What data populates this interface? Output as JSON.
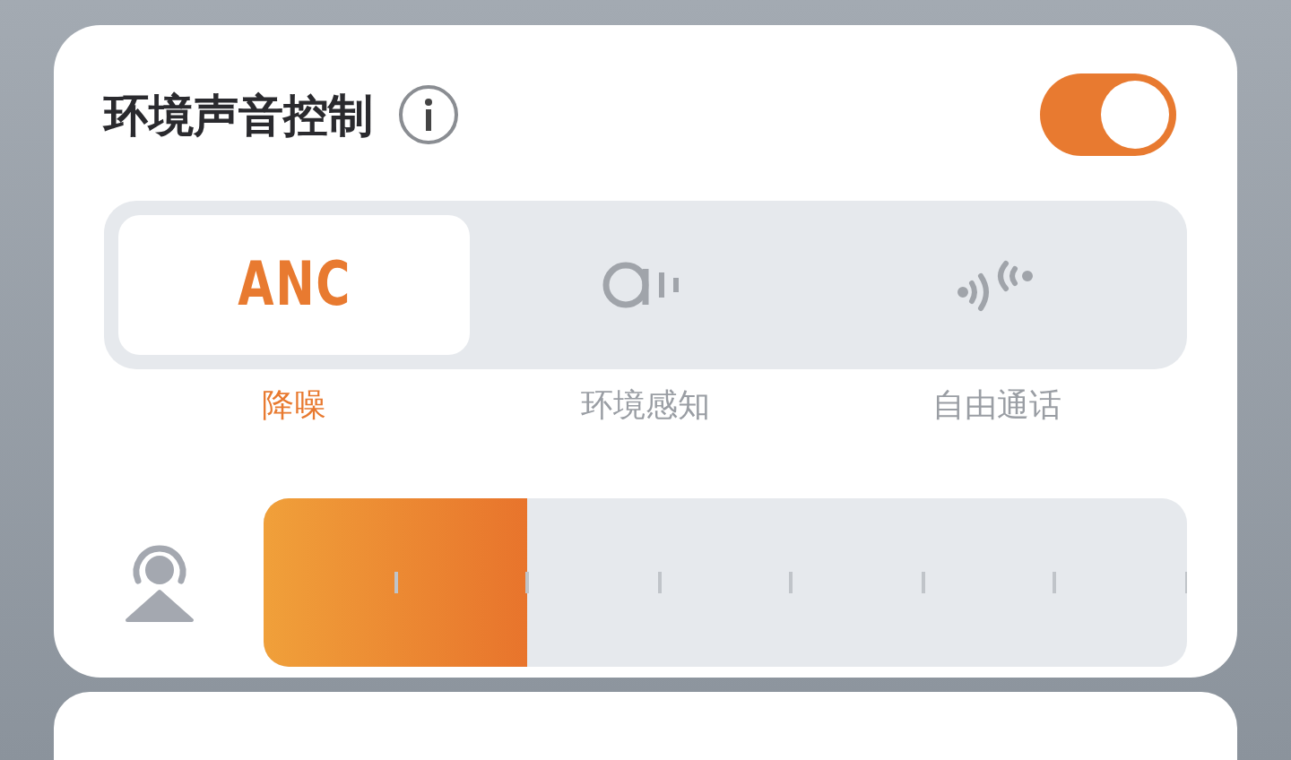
{
  "panel": {
    "title": "环境声音控制",
    "enabled": true
  },
  "modes": [
    {
      "kind": "text",
      "text": "ANC",
      "label": "降噪",
      "selected": true
    },
    {
      "kind": "ambient",
      "label": "环境感知",
      "selected": false
    },
    {
      "kind": "conversation",
      "label": "自由通话",
      "selected": false
    }
  ],
  "level_slider": {
    "level": 0.286
  }
}
